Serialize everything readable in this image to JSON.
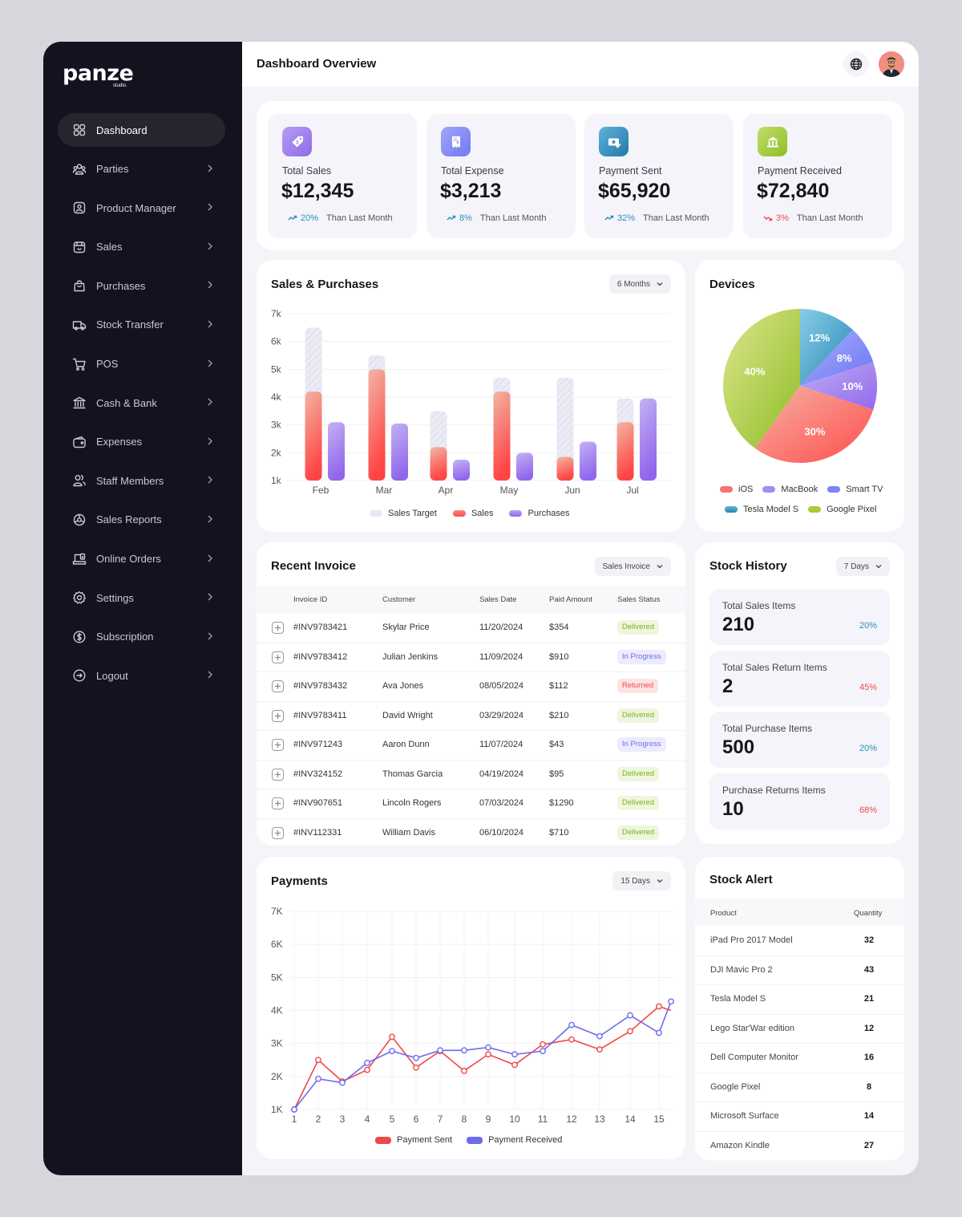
{
  "brand": {
    "name": "panze",
    "sub": "studio."
  },
  "header": {
    "title": "Dashboard Overview"
  },
  "sidebar": {
    "items": [
      {
        "label": "Dashboard",
        "icon": "grid-icon",
        "active": true
      },
      {
        "label": "Parties",
        "icon": "users-icon"
      },
      {
        "label": "Product Manager",
        "icon": "user-square-icon"
      },
      {
        "label": "Sales",
        "icon": "shop-icon"
      },
      {
        "label": "Purchases",
        "icon": "shopping-bag-icon"
      },
      {
        "label": "Stock Transfer",
        "icon": "truck-icon"
      },
      {
        "label": "POS",
        "icon": "cart-icon"
      },
      {
        "label": "Cash & Bank",
        "icon": "bank-icon"
      },
      {
        "label": "Expenses",
        "icon": "wallet-icon"
      },
      {
        "label": "Staff Members",
        "icon": "staff-icon"
      },
      {
        "label": "Sales Reports",
        "icon": "chart-circle-icon"
      },
      {
        "label": "Online Orders",
        "icon": "laptop-icon"
      },
      {
        "label": "Settings",
        "icon": "gear-icon"
      },
      {
        "label": "Subscription",
        "icon": "dollar-circle-icon"
      },
      {
        "label": "Logout",
        "icon": "logout-icon"
      }
    ]
  },
  "stats": [
    {
      "label": "Total Sales",
      "value": "$12,345",
      "pct": "20%",
      "direction": "up",
      "compare": "Than Last Month",
      "icon": "tag-icon",
      "color": "#9d7ef0"
    },
    {
      "label": "Total Expense",
      "value": "$3,213",
      "pct": "8%",
      "direction": "up",
      "compare": "Than Last Month",
      "icon": "receipt-icon",
      "color": "#8a8cf7"
    },
    {
      "label": "Payment Sent",
      "value": "$65,920",
      "pct": "32%",
      "direction": "up",
      "compare": "Than Last Month",
      "icon": "money-check-icon",
      "color": "#2e8fbf"
    },
    {
      "label": "Payment Received",
      "value": "$72,840",
      "pct": "3%",
      "direction": "down",
      "compare": "Than Last Month",
      "icon": "bank-icon",
      "color": "#9cc43a"
    }
  ],
  "sales_purchases": {
    "title": "Sales & Purchases",
    "dropdown": "6 Months",
    "legend": [
      "Sales Target",
      "Sales",
      "Purchases"
    ]
  },
  "devices": {
    "title": "Devices",
    "legend": [
      "iOS",
      "MacBook",
      "Smart TV",
      "Tesla Model S",
      "Google Pixel"
    ]
  },
  "invoice": {
    "title": "Recent Invoice",
    "dropdown": "Sales Invoice",
    "columns": [
      "Invoice ID",
      "Customer",
      "Sales Date",
      "Paid Amount",
      "Sales Status"
    ],
    "rows": [
      {
        "id": "#INV9783421",
        "customer": "Skylar Price",
        "date": "11/20/2024",
        "amount": "$354",
        "status": "Delivered"
      },
      {
        "id": "#INV9783412",
        "customer": "Julian Jenkins",
        "date": "11/09/2024",
        "amount": "$910",
        "status": "In Progress"
      },
      {
        "id": "#INV9783432",
        "customer": "Ava Jones",
        "date": "08/05/2024",
        "amount": "$112",
        "status": "Returned"
      },
      {
        "id": "#INV9783411",
        "customer": "David Wright",
        "date": "03/29/2024",
        "amount": "$210",
        "status": "Delivered"
      },
      {
        "id": "#INV971243",
        "customer": "Aaron Dunn",
        "date": "11/07/2024",
        "amount": "$43",
        "status": "In Progress"
      },
      {
        "id": "#INV324152",
        "customer": "Thomas Garcia",
        "date": "04/19/2024",
        "amount": "$95",
        "status": "Delivered"
      },
      {
        "id": "#INV907651",
        "customer": "Lincoln Rogers",
        "date": "07/03/2024",
        "amount": "$1290",
        "status": "Delivered"
      },
      {
        "id": "#INV112331",
        "customer": "William Davis",
        "date": "06/10/2024",
        "amount": "$710",
        "status": "Delivered"
      }
    ]
  },
  "stock_history": {
    "title": "Stock History",
    "dropdown": "7 Days",
    "items": [
      {
        "label": "Total Sales Items",
        "value": "210",
        "pct": "20%",
        "direction": "up"
      },
      {
        "label": "Total Sales Return Items",
        "value": "2",
        "pct": "45%",
        "direction": "down"
      },
      {
        "label": "Total Purchase Items",
        "value": "500",
        "pct": "20%",
        "direction": "up"
      },
      {
        "label": "Purchase Returns Items",
        "value": "10",
        "pct": "68%",
        "direction": "down"
      }
    ]
  },
  "payments": {
    "title": "Payments",
    "dropdown": "15 Days",
    "legend": [
      "Payment Sent",
      "Payment Received"
    ]
  },
  "stock_alert": {
    "title": "Stock Alert",
    "columns": [
      "Product",
      "Quantity"
    ],
    "rows": [
      {
        "product": "iPad Pro 2017 Model",
        "qty": "32"
      },
      {
        "product": "DJI Mavic Pro 2",
        "qty": "43"
      },
      {
        "product": "Tesla Model S",
        "qty": "21"
      },
      {
        "product": "Lego Star'War edition",
        "qty": "12"
      },
      {
        "product": "Dell Computer Monitor",
        "qty": "16"
      },
      {
        "product": "Google Pixel",
        "qty": "8"
      },
      {
        "product": "Microsoft Surface",
        "qty": "14"
      },
      {
        "product": "Amazon Kindle",
        "qty": "27"
      }
    ]
  },
  "colors": {
    "sidebar_bg": "#131320",
    "up": "#2b8fbd",
    "down": "#f04848",
    "sales": "#ff4d4d",
    "purchases": "#9b78ee",
    "target": "#e9e9f4",
    "payment_sent": "#f04848",
    "payment_received": "#6c6cf0"
  },
  "chart_data": [
    {
      "type": "bar",
      "title": "Sales & Purchases",
      "categories": [
        "Feb",
        "Mar",
        "Apr",
        "May",
        "Jun",
        "Jul"
      ],
      "series": [
        {
          "name": "Sales Target",
          "values": [
            6.5,
            5.5,
            3.5,
            4.7,
            4.7,
            3.95
          ]
        },
        {
          "name": "Sales",
          "values": [
            4.2,
            5.0,
            2.2,
            4.2,
            1.85,
            3.1
          ]
        },
        {
          "name": "Purchases",
          "values": [
            3.1,
            3.05,
            1.75,
            2.0,
            2.4,
            3.95
          ]
        }
      ],
      "yticks": [
        "1k",
        "2k",
        "3k",
        "4k",
        "5k",
        "6k",
        "7k"
      ],
      "ylim": [
        1,
        7
      ],
      "yunit": "k",
      "grid": true,
      "legend_position": "bottom"
    },
    {
      "type": "pie",
      "title": "Devices",
      "slices": [
        {
          "label": "Tesla Model S",
          "value": 12,
          "text": "12%",
          "colors": [
            "#86cdea",
            "#2a86b0"
          ]
        },
        {
          "label": "Smart TV",
          "value": 8,
          "text": "8%",
          "colors": [
            "#a9b2fb",
            "#6b72f5"
          ]
        },
        {
          "label": "MacBook",
          "value": 10,
          "text": "10%",
          "colors": [
            "#bfaef3",
            "#9468ec"
          ]
        },
        {
          "label": "iOS",
          "value": 30,
          "text": "30%",
          "colors": [
            "#f5b3a3",
            "#ff4d4d"
          ]
        },
        {
          "label": "Google Pixel",
          "value": 40,
          "text": "40%",
          "colors": [
            "#dde68e",
            "#8fbd26"
          ]
        }
      ],
      "legend_position": "bottom"
    },
    {
      "type": "line",
      "title": "Payments",
      "x": [
        1,
        2,
        3,
        4,
        5,
        6,
        7,
        8,
        9,
        10,
        11,
        12,
        13,
        14,
        15
      ],
      "series": [
        {
          "name": "Payment Sent",
          "values": [
            1.0,
            2.5,
            1.85,
            2.2,
            3.2,
            2.27,
            2.77,
            2.17,
            2.67,
            2.35,
            2.97,
            3.12,
            2.82,
            3.37,
            4.12
          ],
          "tail": 4.0
        },
        {
          "name": "Payment Received",
          "values": [
            1.0,
            1.93,
            1.81,
            2.41,
            2.77,
            2.56,
            2.79,
            2.79,
            2.88,
            2.67,
            2.77,
            3.56,
            3.22,
            3.85,
            3.32
          ],
          "tail": 4.27
        }
      ],
      "yticks": [
        "1K",
        "2K",
        "3K",
        "4K",
        "5K",
        "6K",
        "7K"
      ],
      "ylim": [
        1,
        7
      ],
      "yunit": "K",
      "grid": true,
      "legend_position": "bottom"
    }
  ]
}
